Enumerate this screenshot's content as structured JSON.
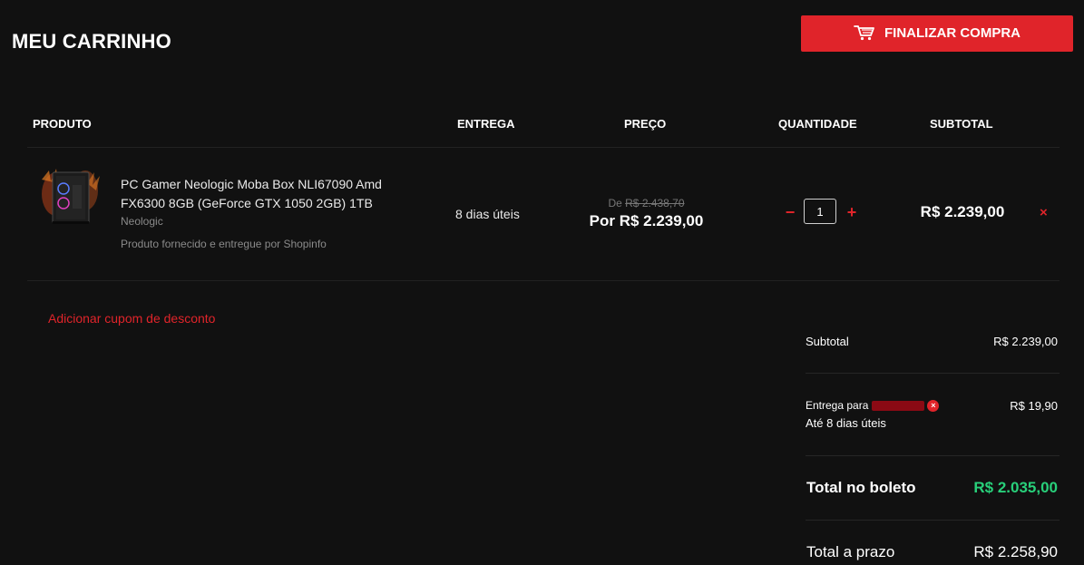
{
  "header": {
    "title": "MEU CARRINHO",
    "checkout_button": "FINALIZAR COMPRA"
  },
  "table": {
    "columns": [
      "PRODUTO",
      "ENTREGA",
      "PREÇO",
      "QUANTIDADE",
      "SUBTOTAL"
    ]
  },
  "item": {
    "name": "PC Gamer Neologic Moba Box NLI67090 Amd FX6300 8GB (GeForce GTX 1050 2GB) 1TB",
    "brand": "Neologic",
    "seller": "Produto fornecido e entregue por Shopinfo",
    "delivery": "8 dias úteis",
    "old_price_prefix": "De",
    "old_price": "R$ 2.438,70",
    "new_price": "Por R$ 2.239,00",
    "quantity": "1",
    "quantity_minus": "−",
    "quantity_plus": "+",
    "subtotal": "R$ 2.239,00",
    "remove": "×"
  },
  "coupon": {
    "link": "Adicionar cupom de desconto"
  },
  "summary": {
    "subtotal_label": "Subtotal",
    "subtotal_value": "R$ 2.239,00",
    "delivery_label": "Entrega para",
    "delivery_value": "R$ 19,90",
    "delivery_eta": "Até 8 dias úteis",
    "clear_icon": "×",
    "boleto_label": "Total no boleto",
    "boleto_value": "R$ 2.035,00",
    "prazo_label": "Total a prazo",
    "prazo_value": "R$ 2.258,90"
  },
  "colors": {
    "background": "#111111",
    "accent_red": "#e0242a",
    "boleto_green": "#28d07a"
  },
  "icons": {
    "checkout": "shopping-cart-icon",
    "remove": "close-icon",
    "clear_cep": "close-circle-icon"
  }
}
